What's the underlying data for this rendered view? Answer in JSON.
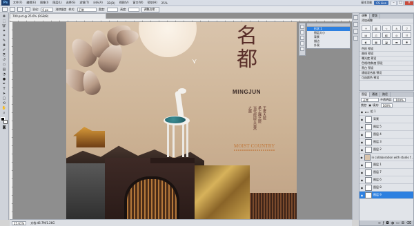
{
  "menubar": {
    "logo": "Ps",
    "items": [
      "文件(F)",
      "编辑(E)",
      "图像(I)",
      "图层(L)",
      "选择(S)",
      "滤镜(T)",
      "分析(A)",
      "3D(D)",
      "视图(V)",
      "窗口(W)",
      "帮助(H)"
    ],
    "zoom": "25%",
    "workspace": "基本功能",
    "cs_live": "CS Live"
  },
  "optbar": {
    "feather_label": "羽化:",
    "feather_value": "0 px",
    "antialias_label": "消除锯齿",
    "style_label": "样式:",
    "style_value": "正常",
    "width_label": "宽度:",
    "height_label": "高度:",
    "refine_edge": "调整边缘..."
  },
  "document": {
    "tab_title": "700.psd @ 25.6% (RGB/8)",
    "zoom": "25.61%",
    "doc_size": "文档:46.7M/1.26G"
  },
  "canvas": {
    "title_top": "名",
    "title_bottom": "都",
    "brand_latin": "MINGJUN",
    "poem_lines": [
      "王者大院",
      "承上器之院",
      "当代府邸大自然",
      "之居"
    ],
    "tagline": "MOIST COUNTRY"
  },
  "nav_panel": {
    "rows": [
      "形状 1",
      "图层大小",
      "背景",
      "描边",
      "外观"
    ]
  },
  "adjustments_panel": {
    "tabs": [
      "调整",
      "蒙版"
    ],
    "add_label": "添加调整",
    "presets": [
      "色阶 预设",
      "曲线 预设",
      "曝光度 预设",
      "色相/饱和度 预设",
      "黑白 预设",
      "通道混合器 预设",
      "可选颜色 预设"
    ]
  },
  "layers_panel": {
    "tabs": [
      "图层",
      "通道",
      "路径"
    ],
    "blend_mode": "正常",
    "opacity_label": "不透明度:",
    "opacity_value": "100%",
    "lock_label": "锁定:",
    "fill_label": "填充:",
    "fill_value": "100%",
    "layers": [
      "组 1",
      "背景",
      "图层 5",
      "图层 4",
      "图层 3",
      "图层 2",
      "in collaboration with studio f...",
      "图层 1",
      "图层 7",
      "图层 6",
      "图层 8",
      "图层 9"
    ]
  },
  "colors": {
    "accent_blue": "#2d80e0",
    "canvas_bg": "#d9c4ac",
    "title_brown": "#5a2f2a",
    "tagline_orange": "#c0773a"
  }
}
